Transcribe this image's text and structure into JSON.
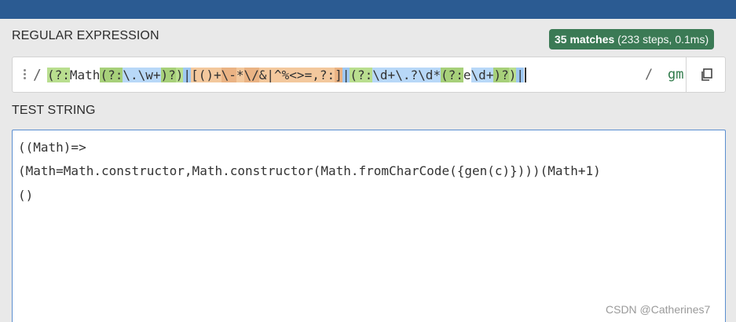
{
  "regex_section": {
    "label": "REGULAR EXPRESSION",
    "match_count": "35 matches",
    "match_detail": "(233 steps, 0.1ms)",
    "delimiter_open": "/",
    "pattern": "(?:Math(?:\\.\\w+)?)|[()+\\-*\\/&|^%<>=,?:]|(?:\\d+\\.?\\d*(?:e\\d+)?)|",
    "delimiter_close": "/",
    "flags": "gm"
  },
  "test_section": {
    "label": "TEST STRING",
    "lines": [
      "((Math)=>",
      "(Math=Math.constructor,Math.constructor(Math.fromCharCode({gen(c)})))(Math+1)",
      "()"
    ]
  },
  "watermark": "CSDN @Catherines7",
  "colors": {
    "topbar": "#2b5b92",
    "badge": "#3b7a55",
    "flags": "#2f7a4a",
    "match_highlight": "#b8d8f8",
    "active_border": "#5b8ed0"
  },
  "icons": {
    "drag": "drag-handle-icon",
    "copy": "copy-icon"
  }
}
